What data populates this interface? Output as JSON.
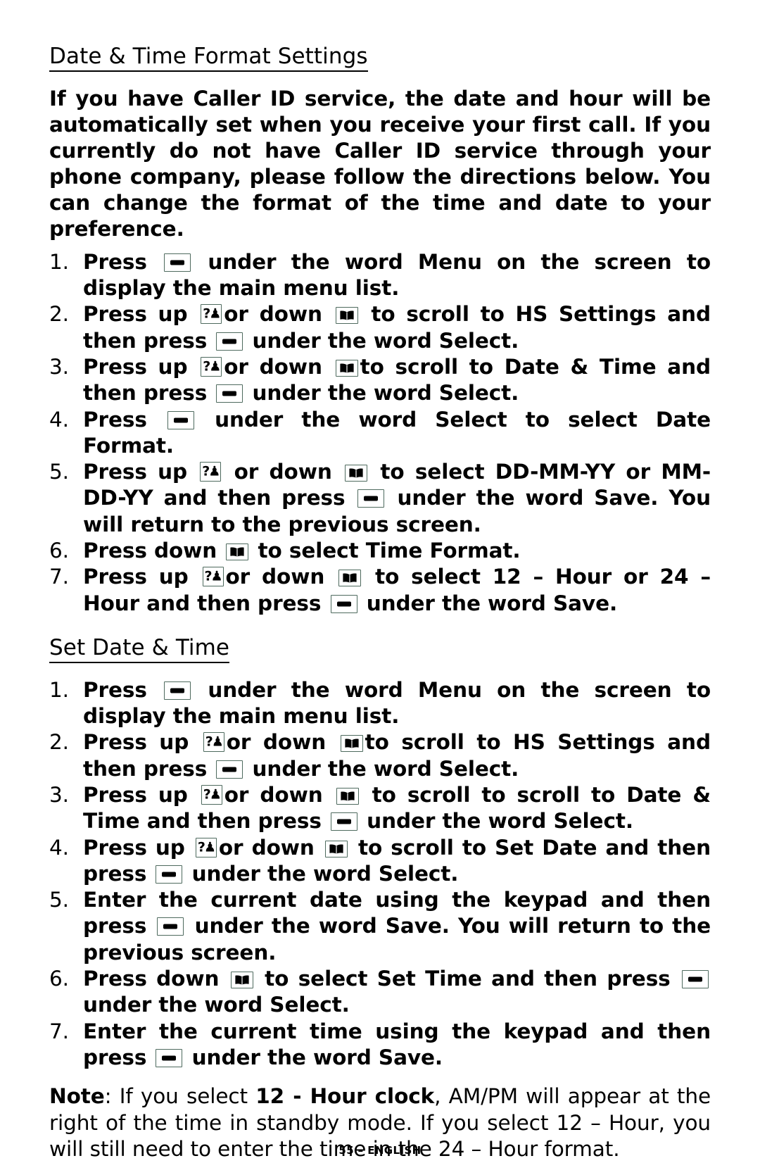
{
  "page": {
    "footer": "55 – ENGLISH"
  },
  "icons": {
    "soft_key": "soft-key-icon",
    "up_key": "up-arrow-key-icon",
    "down_key": "down-arrow-key-icon",
    "up_glyph": "?♟",
    "border_color": "#4e6a5e"
  },
  "sections": [
    {
      "heading": "Date & Time Format Settings",
      "intro": "If you have Caller ID service, the date and hour will be automatically set when you receive your first call.  If you currently do not have Caller ID service through your phone company, please follow the directions below.  You can change the format of the time and date to your preference.",
      "steps": [
        {
          "num": "1.",
          "parts": [
            {
              "t": "text",
              "v": "Press "
            },
            {
              "t": "key",
              "v": "soft"
            },
            {
              "t": "text",
              "v": " under the word "
            },
            {
              "t": "bold",
              "v": "Menu"
            },
            {
              "t": "text",
              "v": " on the screen to display the main menu list."
            }
          ]
        },
        {
          "num": "2.",
          "parts": [
            {
              "t": "text",
              "v": "Press up "
            },
            {
              "t": "key",
              "v": "up"
            },
            {
              "t": "text",
              "v": "or down "
            },
            {
              "t": "key",
              "v": "down"
            },
            {
              "t": "text",
              "v": " to scroll to "
            },
            {
              "t": "bold",
              "v": "HS Settings"
            },
            {
              "t": "text",
              "v": " and then press "
            },
            {
              "t": "key",
              "v": "soft"
            },
            {
              "t": "text",
              "v": " under the word "
            },
            {
              "t": "bold",
              "v": "Select"
            },
            {
              "t": "text",
              "v": "."
            }
          ]
        },
        {
          "num": "3.",
          "parts": [
            {
              "t": "text",
              "v": "Press up "
            },
            {
              "t": "key",
              "v": "up"
            },
            {
              "t": "text",
              "v": "or down "
            },
            {
              "t": "key",
              "v": "down"
            },
            {
              "t": "text",
              "v": "to scroll to "
            },
            {
              "t": "bold",
              "v": "Date & Time"
            },
            {
              "t": "text",
              "v": " and then press "
            },
            {
              "t": "key",
              "v": "soft"
            },
            {
              "t": "text",
              "v": " under the word "
            },
            {
              "t": "bold",
              "v": "Select"
            },
            {
              "t": "text",
              "v": "."
            }
          ]
        },
        {
          "num": "4.",
          "parts": [
            {
              "t": "text",
              "v": "Press "
            },
            {
              "t": "key",
              "v": "soft"
            },
            {
              "t": "text",
              "v": " under the word "
            },
            {
              "t": "bold",
              "v": "Select"
            },
            {
              "t": "text",
              "v": " to select "
            },
            {
              "t": "bold",
              "v": "Date Format"
            },
            {
              "t": "text",
              "v": "."
            }
          ]
        },
        {
          "num": "5.",
          "parts": [
            {
              "t": "text",
              "v": "Press up "
            },
            {
              "t": "key",
              "v": "up"
            },
            {
              "t": "text",
              "v": " or down "
            },
            {
              "t": "key",
              "v": "down"
            },
            {
              "t": "text",
              "v": " to select "
            },
            {
              "t": "bold",
              "v": "DD-MM-YY"
            },
            {
              "t": "text",
              "v": " or "
            },
            {
              "t": "bold",
              "v": "MM-DD-YY"
            },
            {
              "t": "text",
              "v": " and then press "
            },
            {
              "t": "key",
              "v": "soft"
            },
            {
              "t": "text",
              "v": " under the word "
            },
            {
              "t": "bold",
              "v": "Save"
            },
            {
              "t": "text",
              "v": ".  You will return to the previous screen."
            }
          ]
        },
        {
          "num": "6.",
          "parts": [
            {
              "t": "text",
              "v": "Press down "
            },
            {
              "t": "key",
              "v": "down"
            },
            {
              "t": "text",
              "v": " to select "
            },
            {
              "t": "bold",
              "v": "Time Format"
            },
            {
              "t": "text",
              "v": "."
            }
          ]
        },
        {
          "num": "7.",
          "parts": [
            {
              "t": "text",
              "v": "Press up "
            },
            {
              "t": "key",
              "v": "up"
            },
            {
              "t": "text",
              "v": "or down "
            },
            {
              "t": "key",
              "v": "down"
            },
            {
              "t": "text",
              "v": " to select "
            },
            {
              "t": "bold",
              "v": "12 – Hour"
            },
            {
              "t": "text",
              "v": " or "
            },
            {
              "t": "bold",
              "v": "24 – Hour"
            },
            {
              "t": "text",
              "v": " and then press "
            },
            {
              "t": "key",
              "v": "soft"
            },
            {
              "t": "text",
              "v": " under the word "
            },
            {
              "t": "bold",
              "v": "Save"
            },
            {
              "t": "text",
              "v": "."
            }
          ]
        }
      ]
    },
    {
      "heading": "Set Date & Time ",
      "intro": "",
      "steps": [
        {
          "num": "1.",
          "parts": [
            {
              "t": "text",
              "v": "Press "
            },
            {
              "t": "key",
              "v": "soft"
            },
            {
              "t": "text",
              "v": " under the word "
            },
            {
              "t": "bold",
              "v": "Menu"
            },
            {
              "t": "text",
              "v": " on the screen to display the main menu list."
            }
          ]
        },
        {
          "num": "2.",
          "parts": [
            {
              "t": "text",
              "v": "Press up "
            },
            {
              "t": "key",
              "v": "up"
            },
            {
              "t": "text",
              "v": "or down "
            },
            {
              "t": "key",
              "v": "down"
            },
            {
              "t": "text",
              "v": "to scroll to "
            },
            {
              "t": "bold",
              "v": "HS Settings"
            },
            {
              "t": "text",
              "v": " and then press "
            },
            {
              "t": "key",
              "v": "soft"
            },
            {
              "t": "text",
              "v": " under the word "
            },
            {
              "t": "bold",
              "v": "Select"
            },
            {
              "t": "text",
              "v": "."
            }
          ]
        },
        {
          "num": "3.",
          "parts": [
            {
              "t": "text",
              "v": "Press up "
            },
            {
              "t": "key",
              "v": "up"
            },
            {
              "t": "text",
              "v": "or down "
            },
            {
              "t": "key",
              "v": "down"
            },
            {
              "t": "text",
              "v": " to scroll to scroll to "
            },
            {
              "t": "bold",
              "v": "Date & Time"
            },
            {
              "t": "text",
              "v": " and then press "
            },
            {
              "t": "key",
              "v": "soft"
            },
            {
              "t": "text",
              "v": " under the word "
            },
            {
              "t": "bold",
              "v": "Select"
            },
            {
              "t": "text",
              "v": "."
            }
          ]
        },
        {
          "num": "4.",
          "parts": [
            {
              "t": "text",
              "v": "Press up "
            },
            {
              "t": "key",
              "v": "up"
            },
            {
              "t": "text",
              "v": "or down "
            },
            {
              "t": "key",
              "v": "down"
            },
            {
              "t": "text",
              "v": " to scroll to "
            },
            {
              "t": "bold",
              "v": "Set Date"
            },
            {
              "t": "text",
              "v": " and then press "
            },
            {
              "t": "key",
              "v": "soft"
            },
            {
              "t": "text",
              "v": " under the word "
            },
            {
              "t": "bold",
              "v": "Select"
            },
            {
              "t": "text",
              "v": "."
            }
          ]
        },
        {
          "num": "5.",
          "parts": [
            {
              "t": "text",
              "v": "Enter the current date using the keypad and then press "
            },
            {
              "t": "key",
              "v": "soft"
            },
            {
              "t": "text",
              "v": " under the word "
            },
            {
              "t": "bold",
              "v": "Save"
            },
            {
              "t": "text",
              "v": ". You will return to the previous screen."
            }
          ]
        },
        {
          "num": "6.",
          "parts": [
            {
              "t": "text",
              "v": "Press down "
            },
            {
              "t": "key",
              "v": "down"
            },
            {
              "t": "text",
              "v": " to select "
            },
            {
              "t": "bold",
              "v": "Set Time"
            },
            {
              "t": "text",
              "v": " and then press "
            },
            {
              "t": "key",
              "v": "soft"
            },
            {
              "t": "text",
              "v": " under the word "
            },
            {
              "t": "bold",
              "v": "Select"
            },
            {
              "t": "text",
              "v": "."
            }
          ]
        },
        {
          "num": "7.",
          "parts": [
            {
              "t": "text",
              "v": "Enter the current time using the keypad and then press "
            },
            {
              "t": "key",
              "v": "soft"
            },
            {
              "t": "text",
              "v": " under the word "
            },
            {
              "t": "bold",
              "v": "Save"
            },
            {
              "t": "text",
              "v": "."
            }
          ]
        }
      ]
    }
  ],
  "note": {
    "parts": [
      {
        "t": "bold",
        "v": "Note"
      },
      {
        "t": "text",
        "v": ": If you select "
      },
      {
        "t": "bold",
        "v": "12 - Hour clock"
      },
      {
        "t": "text",
        "v": ", AM/PM will appear at the right of the time in standby mode.  If you select 12 – Hour, you will still need to enter the time in the 24 – Hour format."
      }
    ]
  }
}
